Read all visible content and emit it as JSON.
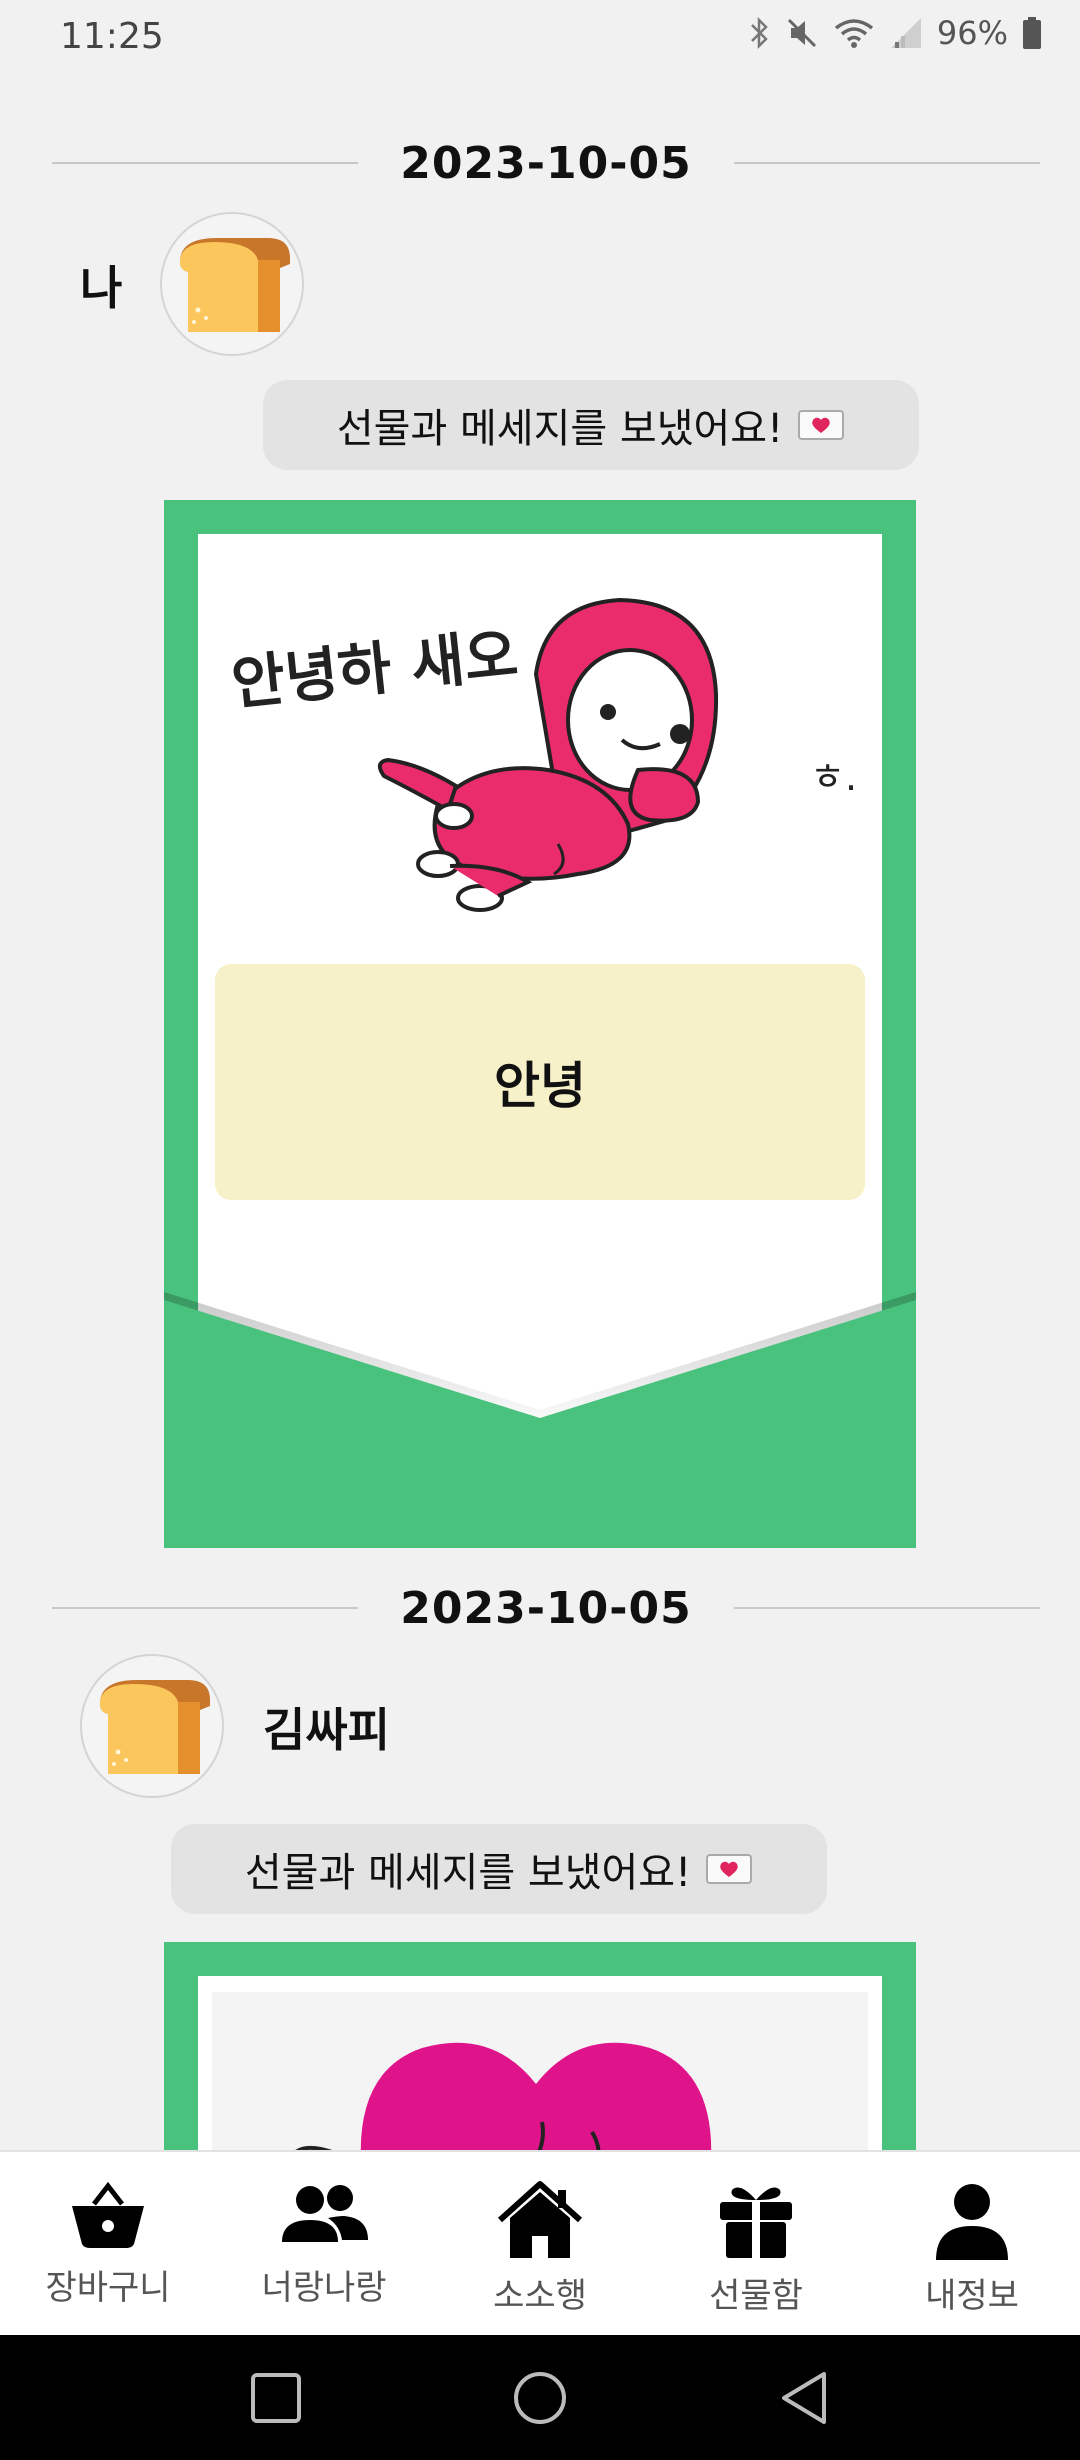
{
  "status_bar": {
    "time": "11:25",
    "battery": "96%"
  },
  "messages": [
    {
      "date": "2023-10-05",
      "sender": "나",
      "notice": "선물과 메세지를 보냈어요!",
      "sticker_text": "안녕하 새오",
      "sticker_text_small": "ㅎ.",
      "card_message": "안녕"
    },
    {
      "date": "2023-10-05",
      "sender": "김싸피",
      "notice": "선물과 메세지를 보냈어요!"
    }
  ],
  "bottom_nav": [
    {
      "label": "장바구니",
      "icon": "basket-icon"
    },
    {
      "label": "너랑나랑",
      "icon": "people-icon"
    },
    {
      "label": "소소행",
      "icon": "home-icon"
    },
    {
      "label": "선물함",
      "icon": "gift-icon"
    },
    {
      "label": "내정보",
      "icon": "person-icon"
    }
  ],
  "colors": {
    "card_green": "#49c27d",
    "message_box": "#f6f1c9",
    "sticker_pink": "#ea2c6d",
    "heart_magenta": "#e0148a"
  }
}
